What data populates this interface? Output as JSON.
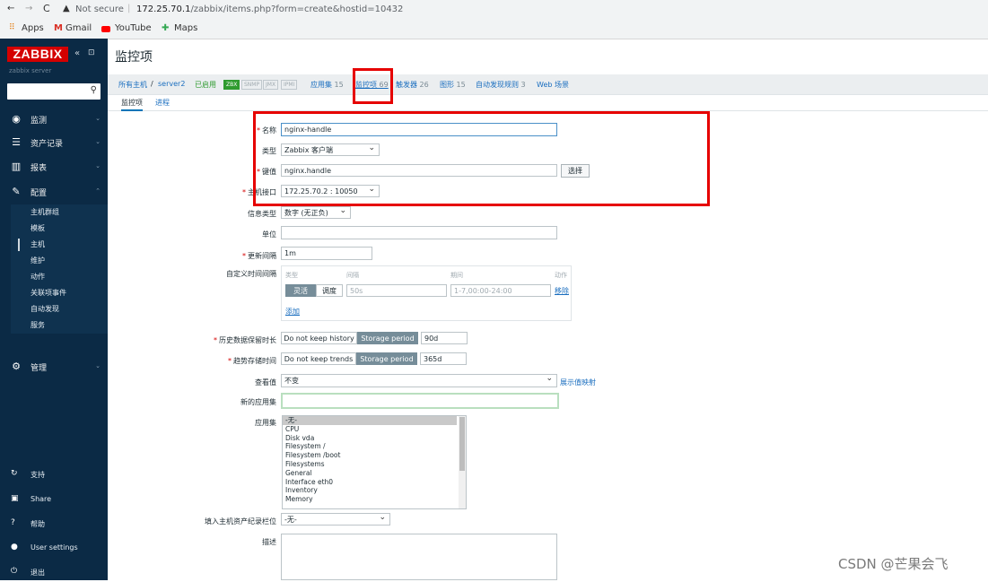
{
  "browser": {
    "security": "Not secure",
    "url_host": "172.25.70.1",
    "url_path": "/zabbix/items.php?form=create&hostid=10432",
    "bookmarks": [
      "Apps",
      "Gmail",
      "YouTube",
      "Maps"
    ]
  },
  "sidebar": {
    "logo": "ZABBIX",
    "server": "zabbix server",
    "menu": [
      {
        "label": "监测",
        "icon": "eye-icon"
      },
      {
        "label": "资产记录",
        "icon": "list-icon"
      },
      {
        "label": "报表",
        "icon": "bar-chart-icon"
      },
      {
        "label": "配置",
        "icon": "wrench-icon"
      },
      {
        "label": "管理",
        "icon": "admin-icon"
      }
    ],
    "submenu": [
      "主机群组",
      "模板",
      "主机",
      "维护",
      "动作",
      "关联项事件",
      "自动发现",
      "服务"
    ],
    "bottom": [
      "支持",
      "Share",
      "帮助",
      "User settings",
      "退出"
    ]
  },
  "page": {
    "title": "监控项",
    "breadcrumb": {
      "all_hosts": "所有主机",
      "sep": "/",
      "host": "server2",
      "enabled": "已启用",
      "tags": [
        "ZBX",
        "SNMP",
        "JMX",
        "IPMI"
      ],
      "apps": "应用集",
      "apps_count": "15",
      "items": "监控项",
      "items_count": "69",
      "triggers": "触发器",
      "triggers_count": "26",
      "graphs": "图形",
      "graphs_count": "15",
      "discovery": "自动发现规则",
      "discovery_count": "3",
      "web": "Web 场景"
    },
    "tabs": [
      "监控项",
      "进程"
    ]
  },
  "form": {
    "name_label": "名称",
    "name_value": "nginx-handle",
    "type_label": "类型",
    "type_value": "Zabbix 客户端",
    "key_label": "键值",
    "key_value": "nginx.handle",
    "select_btn": "选择",
    "interface_label": "主机接口",
    "interface_value": "172.25.70.2 : 10050",
    "info_type_label": "信息类型",
    "info_type_value": "数字 (无正负)",
    "units_label": "单位",
    "units_value": "",
    "interval_label": "更新间隔",
    "interval_value": "1m",
    "custom_intervals_label": "自定义时间间隔",
    "ci_headers": [
      "类型",
      "间隔",
      "期间",
      "动作"
    ],
    "ci_flex": "灵活",
    "ci_sched": "调度",
    "ci_interval_ph": "50s",
    "ci_period_ph": "1-7,00:00-24:00",
    "ci_remove": "移除",
    "ci_add": "添加",
    "history_label": "历史数据保留时长",
    "history_off": "Do not keep history",
    "history_on": "Storage period",
    "history_value": "90d",
    "trends_label": "趋势存储时间",
    "trends_off": "Do not keep trends",
    "trends_on": "Storage period",
    "trends_value": "365d",
    "valuemap_label": "查看值",
    "valuemap_value": "不变",
    "valuemap_link": "展示值映射",
    "new_app_label": "新的应用集",
    "new_app_value": "",
    "apps_label": "应用集",
    "apps_options": [
      "-无-",
      "CPU",
      "Disk vda",
      "Filesystem /",
      "Filesystem /boot",
      "Filesystems",
      "General",
      "Interface eth0",
      "Inventory",
      "Memory"
    ],
    "inventory_label": "填入主机资产纪录栏位",
    "inventory_value": "-无-",
    "desc_label": "描述",
    "desc_value": ""
  },
  "watermark": "CSDN @芒果会飞"
}
